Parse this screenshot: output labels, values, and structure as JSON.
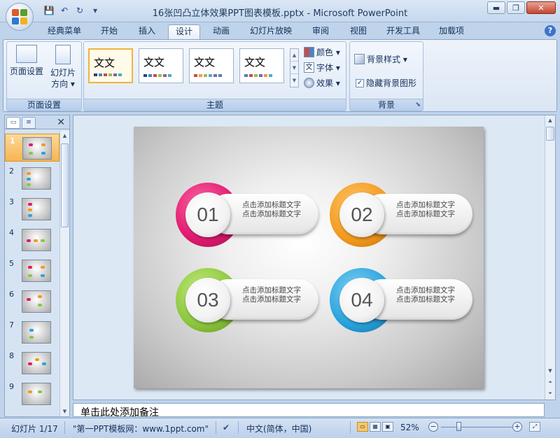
{
  "window": {
    "title": "16张凹凸立体效果PPT图表模板.pptx - Microsoft PowerPoint",
    "minimize": "▬",
    "maximize": "❐",
    "close": "✕"
  },
  "qat": {
    "save_icon": "💾",
    "undo_icon": "↶",
    "redo_icon": "↻",
    "more_icon": "▾"
  },
  "tabs": [
    "经典菜单",
    "开始",
    "插入",
    "设计",
    "动画",
    "幻灯片放映",
    "审阅",
    "视图",
    "开发工具",
    "加载项"
  ],
  "help_icon": "?",
  "ribbon": {
    "page_setup": {
      "page_setup_label": "页面设置",
      "orientation_label": "幻灯片",
      "orientation_label2": "方向 ▾",
      "group_label": "页面设置"
    },
    "themes": {
      "group_label": "主题",
      "items": [
        {
          "text": "文文",
          "swatches": [
            "#1f497d",
            "#4f81bd",
            "#c0504d",
            "#9bbb59",
            "#8064a2",
            "#4bacc6"
          ]
        },
        {
          "text": "文文",
          "swatches": [
            "#1f497d",
            "#4f81bd",
            "#c0504d",
            "#9bbb59",
            "#8064a2",
            "#4bacc6"
          ]
        },
        {
          "text": "文文",
          "swatches": [
            "#c0504d",
            "#f79646",
            "#9bbb59",
            "#4bacc6",
            "#8064a2",
            "#4f81bd"
          ]
        },
        {
          "text": "文文",
          "swatches": [
            "#4f81bd",
            "#c0504d",
            "#9bbb59",
            "#8064a2",
            "#f79646",
            "#4bacc6"
          ]
        }
      ],
      "colors_label": "颜色 ▾",
      "fonts_label": "字体 ▾",
      "effects_label": "效果 ▾"
    },
    "background": {
      "styles_label": "背景样式 ▾",
      "hide_graphics_label": "隐藏背景图形",
      "hide_graphics_checked": "✓",
      "group_label": "背景"
    }
  },
  "left_pane": {
    "tab_slides": "▭",
    "tab_outline": "≡",
    "close": "✕",
    "slides": [
      "1",
      "2",
      "3",
      "4",
      "5",
      "6",
      "7",
      "8",
      "9"
    ],
    "selected": "1"
  },
  "slide": {
    "items": [
      {
        "number": "01",
        "line1": "点击添加标题文字",
        "line2": "点击添加标题文字",
        "color": "#e0196f"
      },
      {
        "number": "02",
        "line1": "点击添加标题文字",
        "line2": "点击添加标题文字",
        "color": "#f39a1e"
      },
      {
        "number": "03",
        "line1": "点击添加标题文字",
        "line2": "点击添加标题文字",
        "color": "#8cc63f"
      },
      {
        "number": "04",
        "line1": "点击添加标题文字",
        "line2": "点击添加标题文字",
        "color": "#29a3dc"
      }
    ]
  },
  "notes": {
    "placeholder": "单击此处添加备注"
  },
  "status": {
    "slide_info": "幻灯片 1/17",
    "theme": "\"第一PPT模板网：www.1ppt.com\"",
    "language": "中文(简体，中国)",
    "zoom": "52%"
  }
}
